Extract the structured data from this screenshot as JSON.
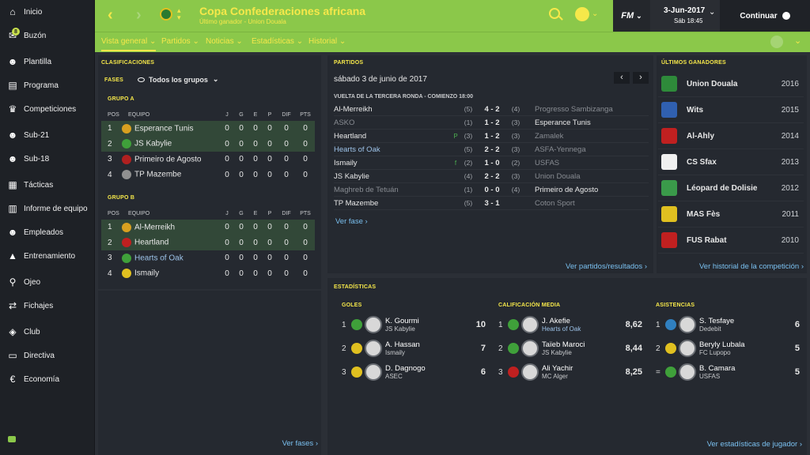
{
  "sidebar": {
    "items": [
      {
        "label": "Inicio",
        "icon": "home-icon",
        "glyph": "⌂"
      },
      {
        "label": "Buzón",
        "icon": "inbox-icon",
        "glyph": "✉",
        "badge": "8"
      },
      {
        "label": "Plantilla",
        "icon": "squad-icon",
        "glyph": "☻"
      },
      {
        "label": "Programa",
        "icon": "schedule-icon",
        "glyph": "▤"
      },
      {
        "label": "Competiciones",
        "icon": "trophy-icon",
        "glyph": "♛"
      },
      {
        "label": "Sub-21",
        "icon": "u21-icon",
        "glyph": "☻"
      },
      {
        "label": "Sub-18",
        "icon": "u18-icon",
        "glyph": "☻"
      },
      {
        "label": "Tácticas",
        "icon": "tactics-icon",
        "glyph": "▦"
      },
      {
        "label": "Informe de equipo",
        "icon": "report-icon",
        "glyph": "▥"
      },
      {
        "label": "Empleados",
        "icon": "staff-icon",
        "glyph": "☻"
      },
      {
        "label": "Entrenamiento",
        "icon": "training-icon",
        "glyph": "▲"
      },
      {
        "label": "Ojeo",
        "icon": "scouting-icon",
        "glyph": "⚲"
      },
      {
        "label": "Fichajes",
        "icon": "transfers-icon",
        "glyph": "⇄"
      },
      {
        "label": "Club",
        "icon": "club-icon",
        "glyph": "◈"
      },
      {
        "label": "Directiva",
        "icon": "board-icon",
        "glyph": "▭"
      },
      {
        "label": "Economía",
        "icon": "finances-icon",
        "glyph": "€"
      }
    ]
  },
  "header": {
    "title": "Copa Confederaciones africana",
    "subtitle": "Último ganador - Union Douala",
    "date": "3-Jun-2017",
    "time": "Sáb 18:45",
    "fm": "FM",
    "continue": "Continuar",
    "tabs": [
      "Vista general",
      "Partidos",
      "Noticias",
      "Estadísticas",
      "Historial"
    ]
  },
  "standings": {
    "heading": "CLASIFICACIONES",
    "phase_label": "FASES",
    "phase_value": "Todos los grupos",
    "columns": [
      "POS",
      "EQUIPO",
      "J",
      "G",
      "E",
      "P",
      "DIF",
      "PTS"
    ],
    "groups": [
      {
        "name": "GRUPO A",
        "rows": [
          {
            "pos": "1",
            "team": "Esperance Tunis",
            "j": "0",
            "g": "0",
            "e": "0",
            "p": "0",
            "dif": "0",
            "pts": "0",
            "hl": true,
            "color": "#d8a020"
          },
          {
            "pos": "2",
            "team": "JS Kabylie",
            "j": "0",
            "g": "0",
            "e": "0",
            "p": "0",
            "dif": "0",
            "pts": "0",
            "hl": true,
            "color": "#3fa03a"
          },
          {
            "pos": "3",
            "team": "Primeiro de Agosto",
            "j": "0",
            "g": "0",
            "e": "0",
            "p": "0",
            "dif": "0",
            "pts": "0",
            "hl": false,
            "color": "#b02020"
          },
          {
            "pos": "4",
            "team": "TP Mazembe",
            "j": "0",
            "g": "0",
            "e": "0",
            "p": "0",
            "dif": "0",
            "pts": "0",
            "hl": false,
            "color": "#909090"
          }
        ]
      },
      {
        "name": "GRUPO B",
        "rows": [
          {
            "pos": "1",
            "team": "Al-Merreikh",
            "j": "0",
            "g": "0",
            "e": "0",
            "p": "0",
            "dif": "0",
            "pts": "0",
            "hl": true,
            "color": "#d8a020"
          },
          {
            "pos": "2",
            "team": "Heartland",
            "j": "0",
            "g": "0",
            "e": "0",
            "p": "0",
            "dif": "0",
            "pts": "0",
            "hl": true,
            "color": "#c02020"
          },
          {
            "pos": "3",
            "team": "Hearts of Oak",
            "j": "0",
            "g": "0",
            "e": "0",
            "p": "0",
            "dif": "0",
            "pts": "0",
            "hl": false,
            "color": "#3fa03a",
            "blue": true
          },
          {
            "pos": "4",
            "team": "Ismaily",
            "j": "0",
            "g": "0",
            "e": "0",
            "p": "0",
            "dif": "0",
            "pts": "0",
            "hl": false,
            "color": "#e0c020"
          }
        ]
      }
    ],
    "link": "Ver fases"
  },
  "matches": {
    "heading": "PARTIDOS",
    "date": "sábado 3 de junio de 2017",
    "round": "VUELTA DE LA TERCERA RONDA - COMIENZO 18:00",
    "rows": [
      {
        "home": "Al-Merreikh",
        "ind": "",
        "hx": "(5)",
        "score": "4 - 2",
        "ax": "(4)",
        "away": "Progresso Sambizanga",
        "hstyle": "",
        "astyle": "dim"
      },
      {
        "home": "ASKO",
        "ind": "",
        "hx": "(1)",
        "score": "1 - 2",
        "ax": "(3)",
        "away": "Esperance Tunis",
        "hstyle": "dim",
        "astyle": ""
      },
      {
        "home": "Heartland",
        "ind": "P",
        "hx": "(3)",
        "score": "1 - 2",
        "ax": "(3)",
        "away": "Zamalek",
        "hstyle": "",
        "astyle": "dim"
      },
      {
        "home": "Hearts of Oak",
        "ind": "",
        "hx": "(5)",
        "score": "2 - 2",
        "ax": "(3)",
        "away": "ASFA-Yennega",
        "hstyle": "hi",
        "astyle": "dim"
      },
      {
        "home": "Ismaily",
        "ind": "f",
        "hx": "(2)",
        "score": "1 - 0",
        "ax": "(2)",
        "away": "USFAS",
        "hstyle": "",
        "astyle": "dim"
      },
      {
        "home": "JS Kabylie",
        "ind": "",
        "hx": "(4)",
        "score": "2 - 2",
        "ax": "(3)",
        "away": "Union Douala",
        "hstyle": "",
        "astyle": "dim"
      },
      {
        "home": "Maghreb de Tetuán",
        "ind": "",
        "hx": "(1)",
        "score": "0 - 0",
        "ax": "(4)",
        "away": "Primeiro de Agosto",
        "hstyle": "dim",
        "astyle": ""
      },
      {
        "home": "TP Mazembe",
        "ind": "",
        "hx": "(5)",
        "score": "3 - 1",
        "ax": "",
        "away": "Coton Sport",
        "hstyle": "",
        "astyle": "dim"
      }
    ],
    "link_phase": "Ver fase",
    "link_results": "Ver partidos/resultados"
  },
  "winners": {
    "heading": "ÚLTIMOS GANADORES",
    "rows": [
      {
        "team": "Union Douala",
        "year": "2016",
        "color": "#2e8a3a"
      },
      {
        "team": "Wits",
        "year": "2015",
        "color": "#3060b0"
      },
      {
        "team": "Al-Ahly",
        "year": "2014",
        "color": "#c02020"
      },
      {
        "team": "CS Sfax",
        "year": "2013",
        "color": "#f0f0f0"
      },
      {
        "team": "Léopard de Dolisie",
        "year": "2012",
        "color": "#3a9a4a"
      },
      {
        "team": "MAS Fès",
        "year": "2011",
        "color": "#e0c020"
      },
      {
        "team": "FUS Rabat",
        "year": "2010",
        "color": "#c02020"
      }
    ],
    "link": "Ver historial de la competición"
  },
  "stats": {
    "heading": "ESTADÍSTICAS",
    "cols": [
      {
        "title": "GOLES",
        "rows": [
          {
            "rank": "1",
            "name": "K. Gourmi",
            "club": "JS Kabylie",
            "value": "10",
            "color": "#3fa03a",
            "blue": false
          },
          {
            "rank": "2",
            "name": "A. Hassan",
            "club": "Ismaily",
            "value": "7",
            "color": "#e0c020",
            "blue": false
          },
          {
            "rank": "3",
            "name": "D. Dagnogo",
            "club": "ASEC",
            "value": "6",
            "color": "#e0c020",
            "blue": false
          }
        ]
      },
      {
        "title": "CALIFICACIÓN MEDIA",
        "rows": [
          {
            "rank": "1",
            "name": "J. Akefie",
            "club": "Hearts of Oak",
            "value": "8,62",
            "color": "#3fa03a",
            "blue": true
          },
          {
            "rank": "2",
            "name": "Taïeb Maroci",
            "club": "JS Kabylie",
            "value": "8,44",
            "color": "#3fa03a",
            "blue": false
          },
          {
            "rank": "3",
            "name": "Ali Yachir",
            "club": "MC Alger",
            "value": "8,25",
            "color": "#c02020",
            "blue": false
          }
        ]
      },
      {
        "title": "ASISTENCIAS",
        "rows": [
          {
            "rank": "1",
            "name": "S. Tesfaye",
            "club": "Dedebit",
            "value": "6",
            "color": "#3080c0",
            "blue": false
          },
          {
            "rank": "2",
            "name": "Beryly Lubala",
            "club": "FC Lupopo",
            "value": "5",
            "color": "#e0c020",
            "blue": false
          },
          {
            "rank": "=",
            "name": "B. Camara",
            "club": "USFAS",
            "value": "5",
            "color": "#3fa03a",
            "blue": false
          }
        ]
      }
    ],
    "link_phases": "Ver fases",
    "link_players": "Ver estadísticas de jugador"
  },
  "colors": {
    "accent": "#8bc84a",
    "title": "#f6e84a",
    "link": "#7ac0f0",
    "highlight_row": "#324838"
  }
}
